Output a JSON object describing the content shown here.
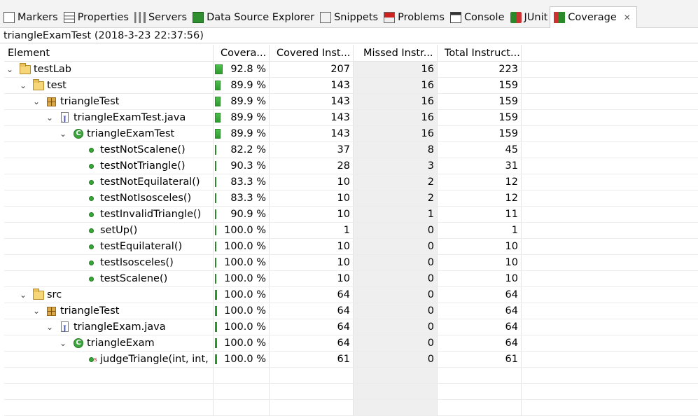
{
  "tabs": [
    {
      "label": "Markers",
      "icon": "markers-icon",
      "active": false
    },
    {
      "label": "Properties",
      "icon": "properties-icon",
      "active": false
    },
    {
      "label": "Servers",
      "icon": "servers-icon",
      "active": false
    },
    {
      "label": "Data Source Explorer",
      "icon": "data-source-icon",
      "active": false
    },
    {
      "label": "Snippets",
      "icon": "snippets-icon",
      "active": false
    },
    {
      "label": "Problems",
      "icon": "problems-icon",
      "active": false
    },
    {
      "label": "Console",
      "icon": "console-icon",
      "active": false
    },
    {
      "label": "JUnit",
      "icon": "junit-icon",
      "active": false
    },
    {
      "label": "Coverage",
      "icon": "coverage-icon",
      "active": true,
      "close": "✕"
    }
  ],
  "session": "triangleExamTest (2018-3-23 22:37:56)",
  "columns": [
    "Element",
    "Covera...",
    "Covered Inst...",
    "Missed Instr...",
    "Total Instruct..."
  ],
  "sort_indicator": "⌄",
  "rows": [
    {
      "level": 0,
      "twisty": "⌄",
      "icon": "project-folder-icon",
      "name": "testLab",
      "coverage": "92.8 %",
      "cov": 0.928,
      "covered": "207",
      "missed": "16",
      "total": "223",
      "total_n": 223
    },
    {
      "level": 1,
      "twisty": "⌄",
      "icon": "source-folder-icon",
      "name": "test",
      "coverage": "89.9 %",
      "cov": 0.899,
      "covered": "143",
      "missed": "16",
      "total": "159",
      "total_n": 159
    },
    {
      "level": 2,
      "twisty": "⌄",
      "icon": "package-icon",
      "name": "triangleTest",
      "coverage": "89.9 %",
      "cov": 0.899,
      "covered": "143",
      "missed": "16",
      "total": "159",
      "total_n": 159
    },
    {
      "level": 3,
      "twisty": "⌄",
      "icon": "java-file-icon",
      "name": "triangleExamTest.java",
      "coverage": "89.9 %",
      "cov": 0.899,
      "covered": "143",
      "missed": "16",
      "total": "159",
      "total_n": 159
    },
    {
      "level": 4,
      "twisty": "⌄",
      "icon": "class-icon",
      "name": "triangleExamTest",
      "coverage": "89.9 %",
      "cov": 0.899,
      "covered": "143",
      "missed": "16",
      "total": "159",
      "total_n": 159
    },
    {
      "level": 5,
      "twisty": "",
      "icon": "method-icon",
      "name": "testNotScalene()",
      "coverage": "82.2 %",
      "cov": 0.822,
      "covered": "37",
      "missed": "8",
      "total": "45",
      "total_n": 45
    },
    {
      "level": 5,
      "twisty": "",
      "icon": "method-icon",
      "name": "testNotTriangle()",
      "coverage": "90.3 %",
      "cov": 0.903,
      "covered": "28",
      "missed": "3",
      "total": "31",
      "total_n": 31
    },
    {
      "level": 5,
      "twisty": "",
      "icon": "method-icon",
      "name": "testNotEquilateral()",
      "coverage": "83.3 %",
      "cov": 0.833,
      "covered": "10",
      "missed": "2",
      "total": "12",
      "total_n": 12
    },
    {
      "level": 5,
      "twisty": "",
      "icon": "method-icon",
      "name": "testNotIsosceles()",
      "coverage": "83.3 %",
      "cov": 0.833,
      "covered": "10",
      "missed": "2",
      "total": "12",
      "total_n": 12
    },
    {
      "level": 5,
      "twisty": "",
      "icon": "method-icon",
      "name": "testInvalidTriangle()",
      "coverage": "90.9 %",
      "cov": 0.909,
      "covered": "10",
      "missed": "1",
      "total": "11",
      "total_n": 11
    },
    {
      "level": 5,
      "twisty": "",
      "icon": "method-icon",
      "name": "setUp()",
      "coverage": "100.0 %",
      "cov": 1.0,
      "covered": "1",
      "missed": "0",
      "total": "1",
      "total_n": 1
    },
    {
      "level": 5,
      "twisty": "",
      "icon": "method-icon",
      "name": "testEquilateral()",
      "coverage": "100.0 %",
      "cov": 1.0,
      "covered": "10",
      "missed": "0",
      "total": "10",
      "total_n": 10
    },
    {
      "level": 5,
      "twisty": "",
      "icon": "method-icon",
      "name": "testIsosceles()",
      "coverage": "100.0 %",
      "cov": 1.0,
      "covered": "10",
      "missed": "0",
      "total": "10",
      "total_n": 10
    },
    {
      "level": 5,
      "twisty": "",
      "icon": "method-icon",
      "name": "testScalene()",
      "coverage": "100.0 %",
      "cov": 1.0,
      "covered": "10",
      "missed": "0",
      "total": "10",
      "total_n": 10
    },
    {
      "level": 1,
      "twisty": "⌄",
      "icon": "source-folder-icon",
      "name": "src",
      "coverage": "100.0 %",
      "cov": 1.0,
      "covered": "64",
      "missed": "0",
      "total": "64",
      "total_n": 64
    },
    {
      "level": 2,
      "twisty": "⌄",
      "icon": "package-icon",
      "name": "triangleTest",
      "coverage": "100.0 %",
      "cov": 1.0,
      "covered": "64",
      "missed": "0",
      "total": "64",
      "total_n": 64
    },
    {
      "level": 3,
      "twisty": "⌄",
      "icon": "java-file-icon",
      "name": "triangleExam.java",
      "coverage": "100.0 %",
      "cov": 1.0,
      "covered": "64",
      "missed": "0",
      "total": "64",
      "total_n": 64
    },
    {
      "level": 4,
      "twisty": "⌄",
      "icon": "class-icon",
      "name": "triangleExam",
      "coverage": "100.0 %",
      "cov": 1.0,
      "covered": "64",
      "missed": "0",
      "total": "64",
      "total_n": 64
    },
    {
      "level": 5,
      "twisty": "",
      "icon": "static-method-icon",
      "name": "judgeTriangle(int, int,",
      "coverage": "100.0 %",
      "cov": 1.0,
      "covered": "61",
      "missed": "0",
      "total": "61",
      "total_n": 61
    }
  ],
  "blank_rows": 3,
  "colors": {
    "covered": "#3cb43c",
    "missed": "#cc3333",
    "missed_column_bg": "#efefef"
  }
}
